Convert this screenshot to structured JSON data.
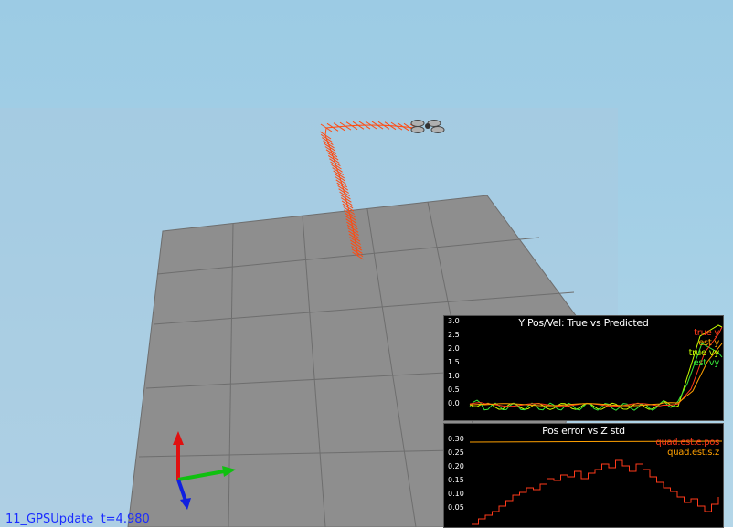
{
  "status": {
    "scenario": "11_GPSUpdate",
    "time": "t=4.980"
  },
  "colors": {
    "sky": "#9ccbe4",
    "trail": "#ff4a10",
    "floor": "#8e8e8e",
    "plot_bg": "#000000"
  },
  "plot1": {
    "title": "Y Pos/Vel: True vs Predicted",
    "legend": [
      {
        "label": "true y",
        "color": "#ff3a1a"
      },
      {
        "label": "est y",
        "color": "#ffa000"
      },
      {
        "label": "true vy",
        "color": "#c8ff00"
      },
      {
        "label": "est vy",
        "color": "#38e838"
      }
    ],
    "yticks": [
      "3.0",
      "2.5",
      "2.0",
      "1.5",
      "1.0",
      "0.5",
      "0.0"
    ]
  },
  "plot2": {
    "title": "Pos error vs Z std",
    "legend": [
      {
        "label": "quad.est.e.pos",
        "color": "#ff3a1a"
      },
      {
        "label": "quad.est.s.z",
        "color": "#ffa000"
      }
    ],
    "yticks": [
      "0.30",
      "0.25",
      "0.20",
      "0.15",
      "0.10",
      "0.05"
    ]
  },
  "icons": {
    "axis": "axis-triad-icon",
    "drone": "quadrotor-icon"
  }
}
